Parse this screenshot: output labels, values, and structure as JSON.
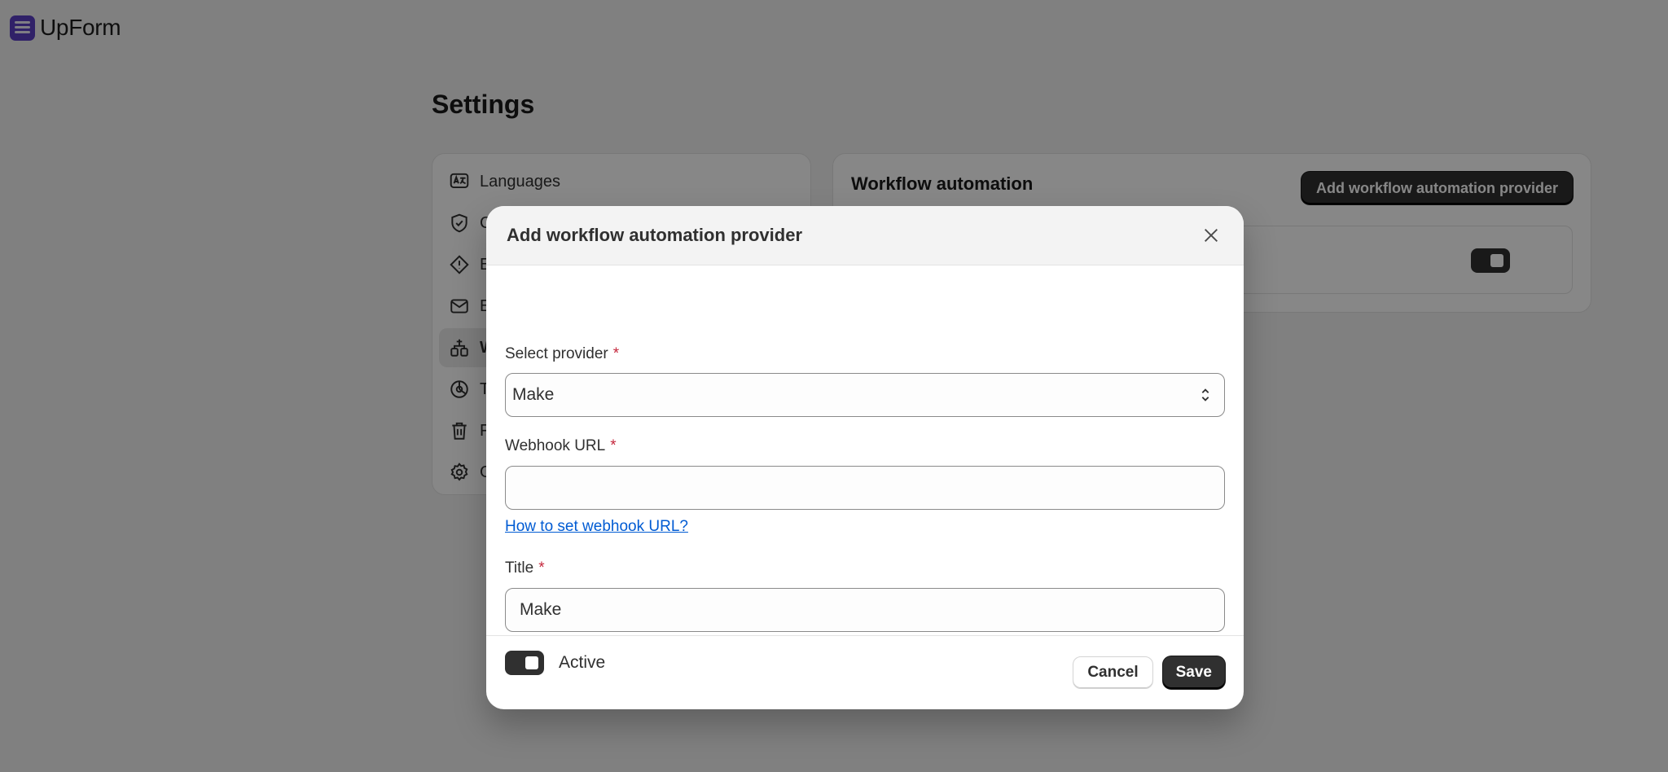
{
  "app": {
    "name": "UpForm"
  },
  "page": {
    "title": "Settings"
  },
  "sidebar": {
    "items": [
      {
        "label": "Languages",
        "icon": "translate-icon",
        "active": false
      },
      {
        "label": "C",
        "icon": "shield-check-icon",
        "active": false
      },
      {
        "label": "E",
        "icon": "alert-diamond-icon",
        "active": false
      },
      {
        "label": "E",
        "icon": "email-icon",
        "active": false
      },
      {
        "label": "W",
        "icon": "workflow-icon",
        "active": true
      },
      {
        "label": "T",
        "icon": "chart-pie-icon",
        "active": false
      },
      {
        "label": "F",
        "icon": "trash-icon",
        "active": false
      },
      {
        "label": "G",
        "icon": "gear-icon",
        "active": false
      }
    ]
  },
  "content": {
    "title": "Workflow automation",
    "add_button": "Add workflow automation provider"
  },
  "modal": {
    "title": "Add workflow automation provider",
    "provider": {
      "label": "Select provider",
      "value": "Make",
      "required": "*"
    },
    "webhook": {
      "label": "Webhook URL",
      "value": "",
      "required": "*",
      "help_link": "How to set webhook URL?"
    },
    "title_field": {
      "label": "Title",
      "value": "Make",
      "required": "*"
    },
    "active": {
      "label": "Active",
      "checked": true
    },
    "cancel_label": "Cancel",
    "save_label": "Save"
  },
  "colors": {
    "brand": "#5b3fc4",
    "primary_button": "#303030",
    "link": "#005bd3",
    "required": "#c5283d"
  }
}
